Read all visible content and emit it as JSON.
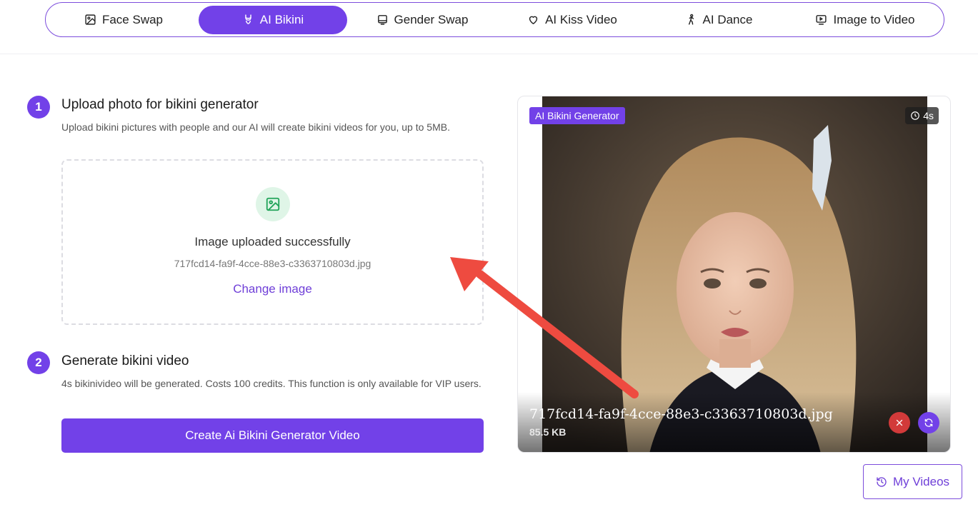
{
  "nav": {
    "tabs": [
      {
        "label": "Face Swap",
        "icon": "image-icon",
        "active": false
      },
      {
        "label": "AI Bikini",
        "icon": "bikini-icon",
        "active": true
      },
      {
        "label": "Gender Swap",
        "icon": "gender-icon",
        "active": false
      },
      {
        "label": "AI Kiss Video",
        "icon": "heart-icon",
        "active": false
      },
      {
        "label": "AI Dance",
        "icon": "dance-icon",
        "active": false
      },
      {
        "label": "Image to Video",
        "icon": "video-icon",
        "active": false
      }
    ]
  },
  "step1": {
    "number": "1",
    "title": "Upload photo for bikini generator",
    "description": "Upload bikini pictures with people and our AI will create bikini videos for you, up to 5MB.",
    "upload_status": "Image uploaded successfully",
    "file_name": "717fcd14-fa9f-4cce-88e3-c3363710803d.jpg",
    "change_label": "Change image"
  },
  "step2": {
    "number": "2",
    "title": "Generate bikini video",
    "description": "4s bikinivideo will be generated. Costs 100 credits. This function is only available for VIP users.",
    "button_label": "Create Ai Bikini Generator Video"
  },
  "preview": {
    "badge": "AI Bikini Generator",
    "duration": "4s",
    "file_name": "717fcd14-fa9f-4cce-88e3-c3363710803d.jpg",
    "file_size": "85.5 KB"
  },
  "my_videos_label": "My Videos",
  "colors": {
    "accent": "#7241e8",
    "success": "#22a45a",
    "danger": "#d23a3a",
    "annotation_arrow": "#ee4b40"
  }
}
